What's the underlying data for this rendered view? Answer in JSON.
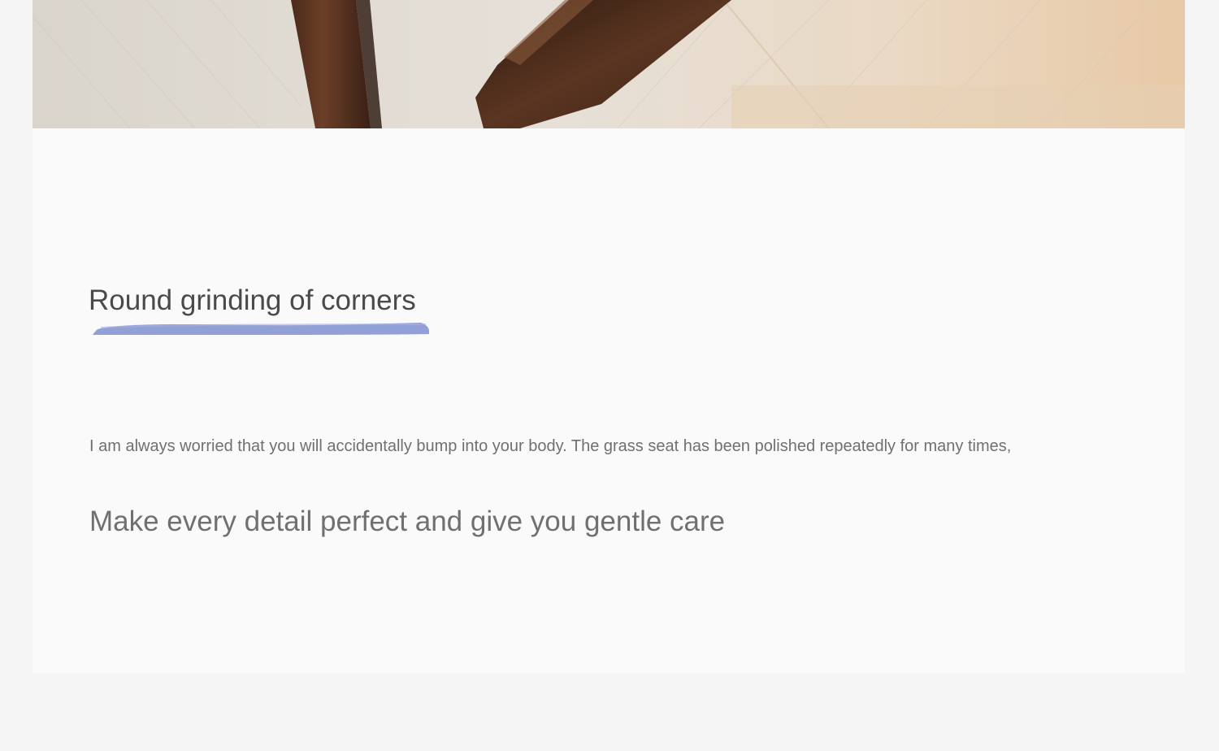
{
  "hero": {
    "image_alt": "wooden chair legs on light wooden floor"
  },
  "section": {
    "title": "Round grinding of corners",
    "underline_color": "#7f8fd0",
    "body": "I am always worried that you will accidentally bump into your body. The grass seat has been polished repeatedly for many times,",
    "tagline": "Make every detail perfect and give you gentle care"
  },
  "colors": {
    "page_background": "#f5f5f5",
    "card_background": "#fafafa",
    "title_text": "#4a4a4a",
    "body_text": "#707070"
  }
}
